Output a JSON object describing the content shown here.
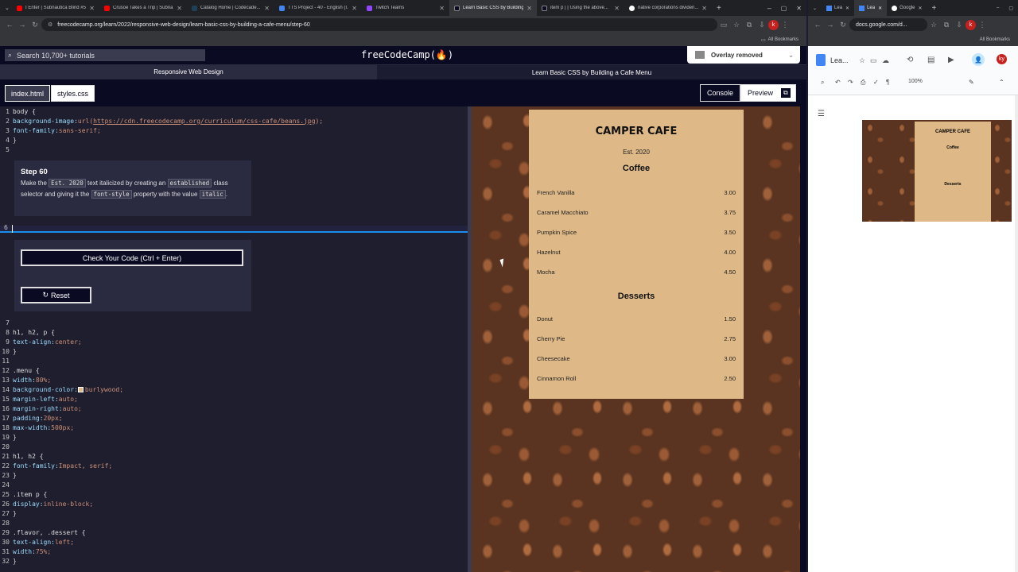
{
  "browser_left": {
    "tabs": [
      {
        "label": "I Enter | Subnautica Blind #5 ...",
        "color": "#ff0000"
      },
      {
        "label": "Crusoe Takes a Trip | Subna...",
        "color": "#ff0000"
      },
      {
        "label": "Catalog Home | Codecade...",
        "color": "#1f4056"
      },
      {
        "label": "TTS Project - 40 - English (I...",
        "color": "#4285f4"
      },
      {
        "label": "Twitch Teams",
        "color": "#9146ff"
      },
      {
        "label": "Learn Basic CSS by Building ...",
        "color": "#0a0a23",
        "active": true
      },
      {
        "label": "item p | | Using the above...",
        "color": "#0a0a23"
      },
      {
        "label": "native corporations dividen...",
        "color": "#4285f4"
      }
    ],
    "url": "freecodecamp.org/learn/2022/responsive-web-design/learn-basic-css-by-building-a-cafe-menu/step-60",
    "bookmarks": "All Bookmarks"
  },
  "fcc": {
    "search_placeholder": "Search 10,700+ tutorials",
    "logo": "freeCodeCamp(🔥)",
    "toast": "Overlay removed",
    "crumb_course": "Responsive Web Design",
    "crumb_project": "Learn Basic CSS by Building a Cafe Menu",
    "file_tabs": [
      "index.html",
      "styles.css"
    ],
    "console_label": "Console",
    "preview_label": "Preview"
  },
  "editor": {
    "line1": "body {",
    "line2_prop": "background-image:",
    "line2_fn": "url(",
    "line2_url": "https://cdn.freecodecamp.org/curriculum/css-cafe/beans.jpg",
    "line2_end": ");",
    "line3_prop": "font-family:",
    "line3_val": "sans-serif;",
    "line4": "}",
    "line6": "",
    "line8": "h1, h2, p {",
    "line9_prop": "text-align:",
    "line9_val": "center;",
    "line10": "}",
    "line12": ".menu {",
    "line13_prop": "width:",
    "line13_val": "80%;",
    "line14_prop": "background-color:",
    "line14_val": "burlywood;",
    "line15_prop": "margin-left:",
    "line15_val": "auto;",
    "line16_prop": "margin-right:",
    "line16_val": "auto;",
    "line17_prop": "padding:",
    "line17_val": "20px;",
    "line18_prop": "max-width:",
    "line18_val": "500px;",
    "line19": "}",
    "line21": "h1, h2 {",
    "line22_prop": "font-family:",
    "line22_val": "Impact, serif;",
    "line23": "}",
    "line25": ".item p {",
    "line26_prop": "display:",
    "line26_val": "inline-block;",
    "line27": "}",
    "line29": ".flavor, .dessert {",
    "line30_prop": "text-align:",
    "line30_val": "left;",
    "line31_prop": "width:",
    "line31_val": "75%;",
    "line32": "}"
  },
  "step": {
    "title": "Step 60",
    "t1": "Make the",
    "c1": "Est. 2020",
    "t2": "text italicized by creating an",
    "c2": "established",
    "t3": "class selector and giving it the",
    "c3": "font-style",
    "t4": "property with the value",
    "c4": "italic",
    "t5": ".",
    "check_label": "Check Your Code (Ctrl + Enter)",
    "reset_label": "Reset"
  },
  "cafe": {
    "title": "CAMPER CAFE",
    "est": "Est. 2020",
    "coffee_heading": "Coffee",
    "coffee": [
      {
        "name": "French Vanilla",
        "price": "3.00"
      },
      {
        "name": "Caramel Macchiato",
        "price": "3.75"
      },
      {
        "name": "Pumpkin Spice",
        "price": "3.50"
      },
      {
        "name": "Hazelnut",
        "price": "4.00"
      },
      {
        "name": "Mocha",
        "price": "4.50"
      }
    ],
    "desserts_heading": "Desserts",
    "desserts": [
      {
        "name": "Donut",
        "price": "1.50"
      },
      {
        "name": "Cherry Pie",
        "price": "2.75"
      },
      {
        "name": "Cheesecake",
        "price": "3.00"
      },
      {
        "name": "Cinnamon Roll",
        "price": "2.50"
      }
    ]
  },
  "browser_right": {
    "tabs": [
      "Lea",
      "Lea",
      "Google"
    ],
    "url": "docs.google.com/d...",
    "bookmarks": "All Bookmarks",
    "doc_name": "Lea...",
    "zoom": "100%",
    "avatar": "ky",
    "thumb_title": "CAMPER CAFE",
    "thumb_coffee": "Coffee",
    "thumb_desserts": "Desserts"
  }
}
